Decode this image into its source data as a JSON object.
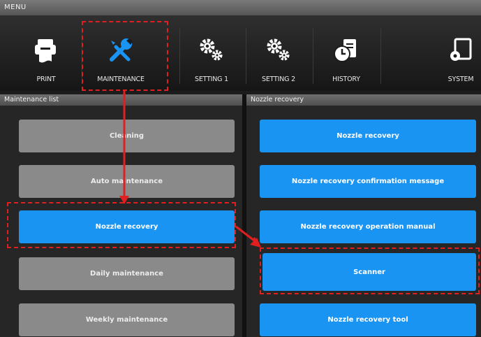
{
  "menu": {
    "title": "MENU"
  },
  "toolbar": {
    "items": [
      {
        "label": "PRINT",
        "icon": "print-icon"
      },
      {
        "label": "MAINTENANCE",
        "icon": "wrench-screwdriver-icon"
      },
      {
        "label": "SETTING 1",
        "icon": "gears-icon"
      },
      {
        "label": "SETTING 2",
        "icon": "gears-icon"
      },
      {
        "label": "HISTORY",
        "icon": "history-clock-icon"
      },
      {
        "label": "SYSTEM",
        "icon": "system-icon"
      }
    ],
    "selected": "MAINTENANCE"
  },
  "left_panel": {
    "title": "Maintenance list",
    "items": [
      {
        "label": "Cleaning"
      },
      {
        "label": "Auto maintenance"
      },
      {
        "label": "Nozzle recovery"
      },
      {
        "label": "Daily maintenance"
      },
      {
        "label": "Weekly maintenance"
      }
    ],
    "selected": "Nozzle recovery"
  },
  "right_panel": {
    "title": "Nozzle recovery",
    "items": [
      {
        "label": "Nozzle recovery"
      },
      {
        "label": "Nozzle recovery confirmation message"
      },
      {
        "label": "Nozzle recovery operation manual"
      },
      {
        "label": "Scanner"
      },
      {
        "label": "Nozzle recovery tool"
      }
    ]
  },
  "colors": {
    "accent_blue": "#1a94f2",
    "button_gray": "#8a8a8a",
    "annotation_red": "#e02020"
  }
}
